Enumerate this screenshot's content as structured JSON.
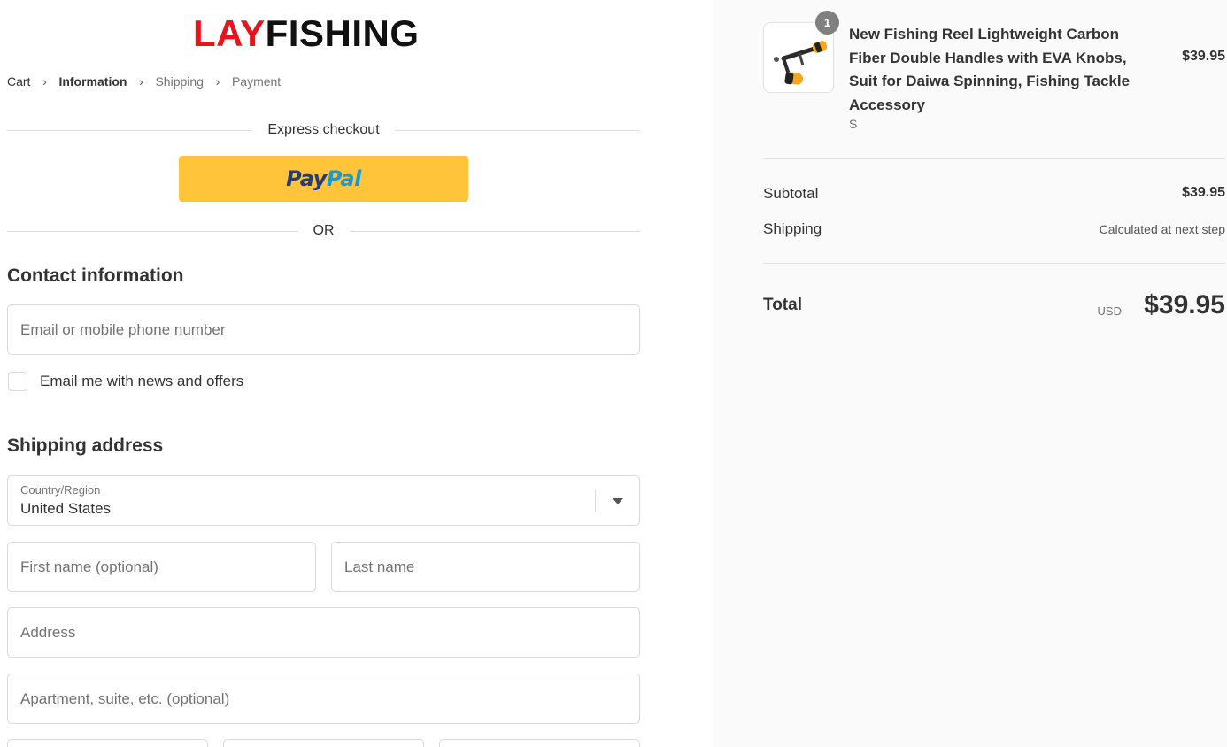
{
  "brand": {
    "logo_red": "LAY",
    "logo_black": "FISHING"
  },
  "breadcrumb": {
    "items": [
      "Cart",
      "Information",
      "Shipping",
      "Payment"
    ],
    "active": "Information"
  },
  "express": {
    "title": "Express checkout",
    "paypal_pay": "Pay",
    "paypal_pal": "Pal",
    "or": "OR"
  },
  "contact": {
    "title": "Contact information",
    "email_placeholder": "Email or mobile phone number",
    "newsletter_label": "Email me with news and offers"
  },
  "shipping": {
    "title": "Shipping address",
    "country_label": "Country/Region",
    "country_value": "United States",
    "first_name_placeholder": "First name (optional)",
    "last_name_placeholder": "Last name",
    "address_placeholder": "Address",
    "apartment_placeholder": "Apartment, suite, etc. (optional)"
  },
  "summary": {
    "product_title": "New Fishing Reel Lightweight Carbon Fiber Double Handles with EVA Knobs, Suit for Daiwa Spinning, Fishing Tackle Accessory",
    "variant": "S",
    "quantity": "1",
    "price": "$39.95",
    "subtotal_label": "Subtotal",
    "subtotal_value": "$39.95",
    "shipping_label": "Shipping",
    "shipping_value": "Calculated at next step",
    "total_label": "Total",
    "currency": "USD",
    "total_value": "$39.95"
  },
  "colors": {
    "logo_red": "#e8141c",
    "paypal_yellow": "#ffc439",
    "paypal_blue_dark": "#253b80",
    "paypal_blue_light": "#179bd7"
  }
}
